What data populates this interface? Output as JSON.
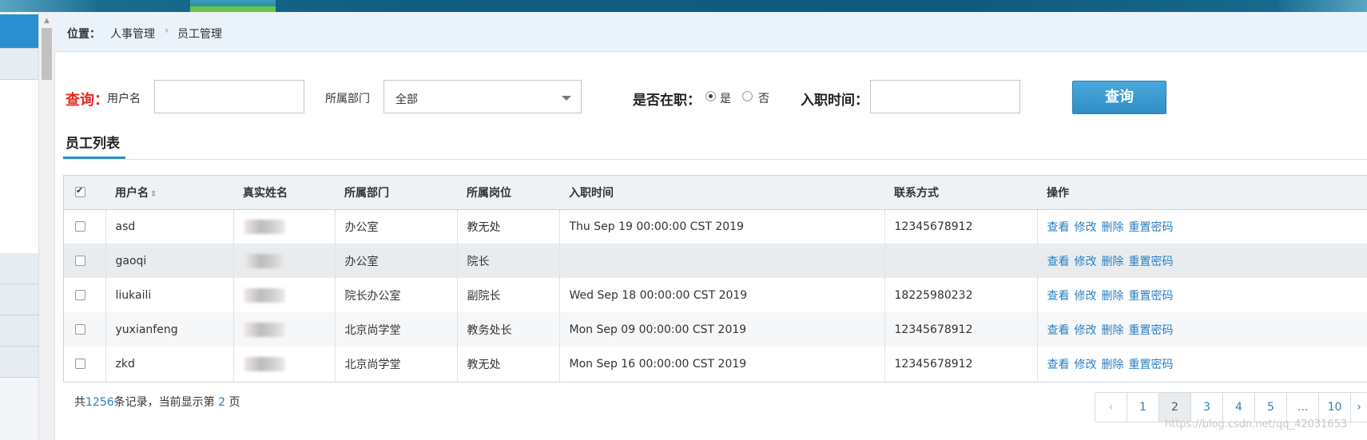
{
  "breadcrumb": {
    "label": "位置：",
    "items": [
      "人事管理",
      "员工管理"
    ],
    "separator": "›"
  },
  "search": {
    "query_label": "查询：",
    "username_label": "用户名",
    "username_value": "",
    "dept_label": "所属部门",
    "dept_value": "全部",
    "employed_label": "是否在职：",
    "employed_yes": "是",
    "employed_no": "否",
    "employed_selected": "是",
    "hire_date_label": "入职时间：",
    "hire_date_value": "",
    "button_label": "查询"
  },
  "section": {
    "title": "员工列表"
  },
  "table": {
    "headers": [
      "",
      "用户名",
      "真实姓名",
      "所属部门",
      "所属岗位",
      "入职时间",
      "联系方式",
      "操作"
    ],
    "rows": [
      {
        "username": "asd",
        "realname": "",
        "dept": "办公室",
        "post": "教无处",
        "hire": "Thu Sep 19 00:00:00 CST 2019",
        "phone": "12345678912"
      },
      {
        "username": "gaoqi",
        "realname": "",
        "dept": "办公室",
        "post": "院长",
        "hire": "",
        "phone": ""
      },
      {
        "username": "liukaili",
        "realname": "",
        "dept": "院长办公室",
        "post": "副院长",
        "hire": "Wed Sep 18 00:00:00 CST 2019",
        "phone": "18225980232"
      },
      {
        "username": "yuxianfeng",
        "realname": "",
        "dept": "北京尚学堂",
        "post": "教务处长",
        "hire": "Mon Sep 09 00:00:00 CST 2019",
        "phone": "12345678912"
      },
      {
        "username": "zkd",
        "realname": "",
        "dept": "北京尚学堂",
        "post": "教无处",
        "hire": "Mon Sep 16 00:00:00 CST 2019",
        "phone": "12345678912"
      }
    ],
    "actions": [
      "查看",
      "修改",
      "删除",
      "重置密码"
    ]
  },
  "footer": {
    "total_prefix": "共",
    "total_count": "1256",
    "total_mid": "条记录，当前显示第",
    "current_page": "2",
    "total_suffix": "页"
  },
  "pagination": {
    "prev": "‹",
    "pages": [
      "1",
      "2",
      "3",
      "4",
      "5",
      "...",
      "10"
    ],
    "next": "›",
    "active": "2"
  },
  "watermark": "https://blog.csdn.net/qq_42031653",
  "colors": {
    "accent": "#2f8ec6",
    "query_red": "#e4271f",
    "link": "#2a7fc0"
  }
}
